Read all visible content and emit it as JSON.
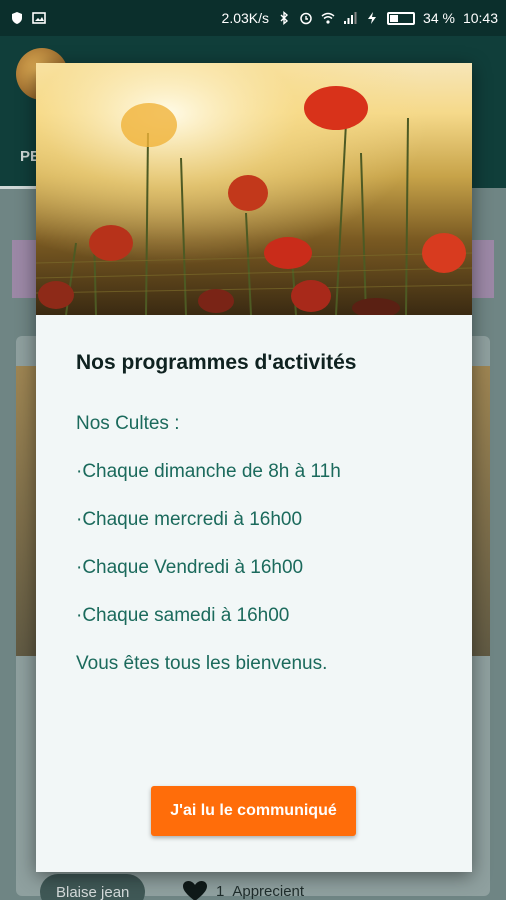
{
  "status_bar": {
    "speed": "2.03K/s",
    "battery_percent": "34 %",
    "battery_level": 0.34,
    "time": "10:43",
    "icons": [
      "shield-icon",
      "image-icon",
      "bluetooth-icon",
      "alarm-icon",
      "wifi-icon",
      "signal-icon",
      "charging-icon",
      "battery-icon"
    ]
  },
  "background_app": {
    "tab_partial": "PE",
    "chip_label": "Blaise jean",
    "likes_count": "1",
    "likes_label": "Apprecient"
  },
  "dialog": {
    "title": "Nos programmes d'activités",
    "lines": [
      "Nos Cultes :",
      "·Chaque dimanche de 8h à 11h",
      "·Chaque mercredi à 16h00",
      "·Chaque Vendredi à 16h00",
      "·Chaque samedi à 16h00",
      "Vous êtes tous les bienvenus."
    ],
    "button_label": "J'ai lu le communiqué"
  },
  "colors": {
    "accent_button": "#ff6d0a",
    "text_green": "#1b6a5c",
    "header_dark": "#103e3a"
  }
}
